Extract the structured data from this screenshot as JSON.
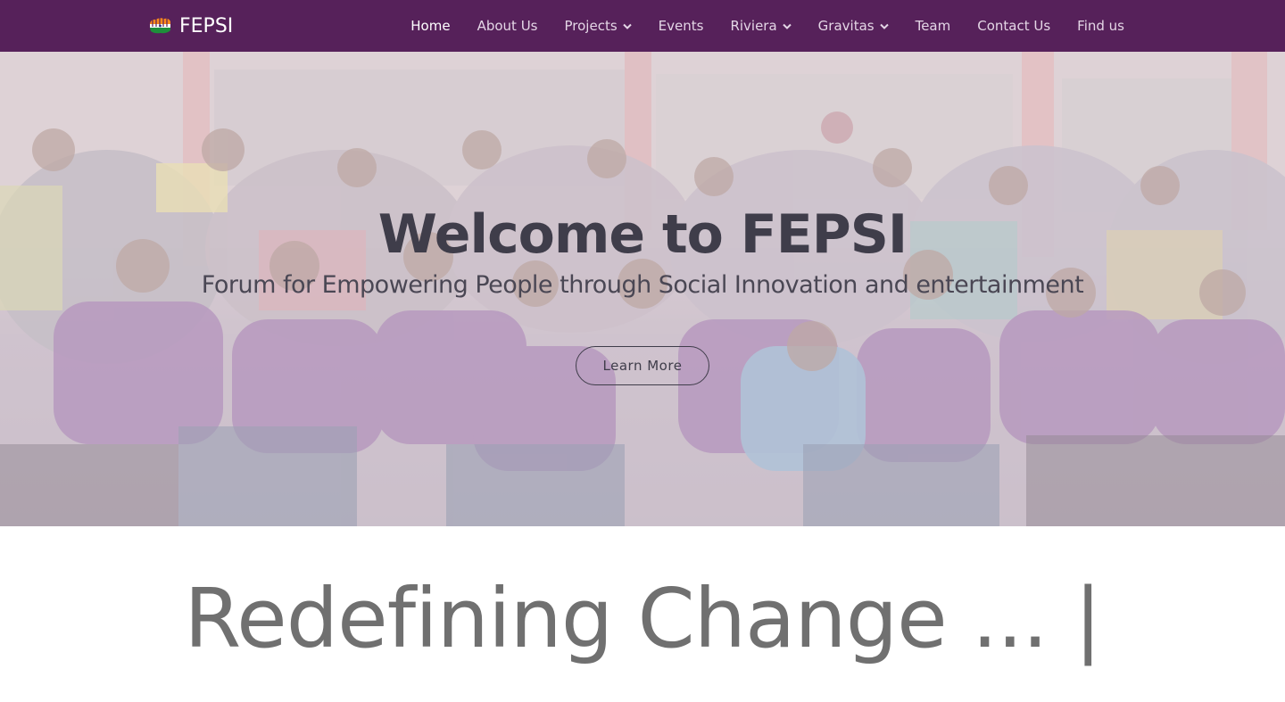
{
  "brand": {
    "name": "FEPSI",
    "logo_icon": "flag-hands-logo-icon"
  },
  "nav": {
    "items": [
      {
        "label": "Home",
        "active": true,
        "dropdown": false
      },
      {
        "label": "About Us",
        "active": false,
        "dropdown": false
      },
      {
        "label": "Projects",
        "active": false,
        "dropdown": true
      },
      {
        "label": "Events",
        "active": false,
        "dropdown": false
      },
      {
        "label": "Riviera",
        "active": false,
        "dropdown": true
      },
      {
        "label": "Gravitas",
        "active": false,
        "dropdown": true
      },
      {
        "label": "Team",
        "active": false,
        "dropdown": false
      },
      {
        "label": "Contact Us",
        "active": false,
        "dropdown": false
      },
      {
        "label": "Find us",
        "active": false,
        "dropdown": false
      }
    ],
    "dropdown_icon": "chevron-down-icon"
  },
  "hero": {
    "title": "Welcome to FEPSI",
    "subtitle": "Forum for Empowering People through Social Innovation and entertainment",
    "button_label": "Learn More",
    "background": "group-photo-image"
  },
  "section": {
    "heading": "Redefining Change ...",
    "cursor": "|"
  },
  "colors": {
    "navbar": "#56215a",
    "nav_text": "#e4d6e6",
    "nav_active": "#ffffff",
    "hero_text": "#3f3d4a",
    "heading_text": "#707070"
  }
}
